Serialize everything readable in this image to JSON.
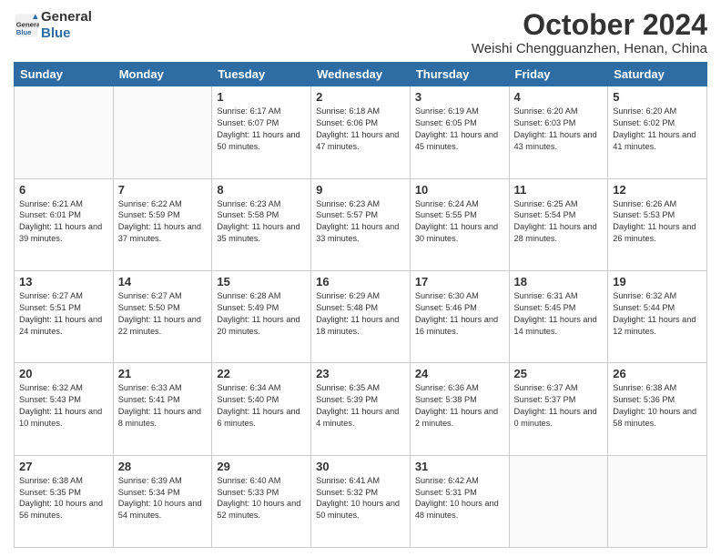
{
  "header": {
    "logo_line1": "General",
    "logo_line2": "Blue",
    "month_title": "October 2024",
    "location": "Weishi Chengguanzhen, Henan, China"
  },
  "days_of_week": [
    "Sunday",
    "Monday",
    "Tuesday",
    "Wednesday",
    "Thursday",
    "Friday",
    "Saturday"
  ],
  "weeks": [
    [
      {
        "day": "",
        "info": ""
      },
      {
        "day": "",
        "info": ""
      },
      {
        "day": "1",
        "info": "Sunrise: 6:17 AM\nSunset: 6:07 PM\nDaylight: 11 hours and 50 minutes."
      },
      {
        "day": "2",
        "info": "Sunrise: 6:18 AM\nSunset: 6:06 PM\nDaylight: 11 hours and 47 minutes."
      },
      {
        "day": "3",
        "info": "Sunrise: 6:19 AM\nSunset: 6:05 PM\nDaylight: 11 hours and 45 minutes."
      },
      {
        "day": "4",
        "info": "Sunrise: 6:20 AM\nSunset: 6:03 PM\nDaylight: 11 hours and 43 minutes."
      },
      {
        "day": "5",
        "info": "Sunrise: 6:20 AM\nSunset: 6:02 PM\nDaylight: 11 hours and 41 minutes."
      }
    ],
    [
      {
        "day": "6",
        "info": "Sunrise: 6:21 AM\nSunset: 6:01 PM\nDaylight: 11 hours and 39 minutes."
      },
      {
        "day": "7",
        "info": "Sunrise: 6:22 AM\nSunset: 5:59 PM\nDaylight: 11 hours and 37 minutes."
      },
      {
        "day": "8",
        "info": "Sunrise: 6:23 AM\nSunset: 5:58 PM\nDaylight: 11 hours and 35 minutes."
      },
      {
        "day": "9",
        "info": "Sunrise: 6:23 AM\nSunset: 5:57 PM\nDaylight: 11 hours and 33 minutes."
      },
      {
        "day": "10",
        "info": "Sunrise: 6:24 AM\nSunset: 5:55 PM\nDaylight: 11 hours and 30 minutes."
      },
      {
        "day": "11",
        "info": "Sunrise: 6:25 AM\nSunset: 5:54 PM\nDaylight: 11 hours and 28 minutes."
      },
      {
        "day": "12",
        "info": "Sunrise: 6:26 AM\nSunset: 5:53 PM\nDaylight: 11 hours and 26 minutes."
      }
    ],
    [
      {
        "day": "13",
        "info": "Sunrise: 6:27 AM\nSunset: 5:51 PM\nDaylight: 11 hours and 24 minutes."
      },
      {
        "day": "14",
        "info": "Sunrise: 6:27 AM\nSunset: 5:50 PM\nDaylight: 11 hours and 22 minutes."
      },
      {
        "day": "15",
        "info": "Sunrise: 6:28 AM\nSunset: 5:49 PM\nDaylight: 11 hours and 20 minutes."
      },
      {
        "day": "16",
        "info": "Sunrise: 6:29 AM\nSunset: 5:48 PM\nDaylight: 11 hours and 18 minutes."
      },
      {
        "day": "17",
        "info": "Sunrise: 6:30 AM\nSunset: 5:46 PM\nDaylight: 11 hours and 16 minutes."
      },
      {
        "day": "18",
        "info": "Sunrise: 6:31 AM\nSunset: 5:45 PM\nDaylight: 11 hours and 14 minutes."
      },
      {
        "day": "19",
        "info": "Sunrise: 6:32 AM\nSunset: 5:44 PM\nDaylight: 11 hours and 12 minutes."
      }
    ],
    [
      {
        "day": "20",
        "info": "Sunrise: 6:32 AM\nSunset: 5:43 PM\nDaylight: 11 hours and 10 minutes."
      },
      {
        "day": "21",
        "info": "Sunrise: 6:33 AM\nSunset: 5:41 PM\nDaylight: 11 hours and 8 minutes."
      },
      {
        "day": "22",
        "info": "Sunrise: 6:34 AM\nSunset: 5:40 PM\nDaylight: 11 hours and 6 minutes."
      },
      {
        "day": "23",
        "info": "Sunrise: 6:35 AM\nSunset: 5:39 PM\nDaylight: 11 hours and 4 minutes."
      },
      {
        "day": "24",
        "info": "Sunrise: 6:36 AM\nSunset: 5:38 PM\nDaylight: 11 hours and 2 minutes."
      },
      {
        "day": "25",
        "info": "Sunrise: 6:37 AM\nSunset: 5:37 PM\nDaylight: 11 hours and 0 minutes."
      },
      {
        "day": "26",
        "info": "Sunrise: 6:38 AM\nSunset: 5:36 PM\nDaylight: 10 hours and 58 minutes."
      }
    ],
    [
      {
        "day": "27",
        "info": "Sunrise: 6:38 AM\nSunset: 5:35 PM\nDaylight: 10 hours and 56 minutes."
      },
      {
        "day": "28",
        "info": "Sunrise: 6:39 AM\nSunset: 5:34 PM\nDaylight: 10 hours and 54 minutes."
      },
      {
        "day": "29",
        "info": "Sunrise: 6:40 AM\nSunset: 5:33 PM\nDaylight: 10 hours and 52 minutes."
      },
      {
        "day": "30",
        "info": "Sunrise: 6:41 AM\nSunset: 5:32 PM\nDaylight: 10 hours and 50 minutes."
      },
      {
        "day": "31",
        "info": "Sunrise: 6:42 AM\nSunset: 5:31 PM\nDaylight: 10 hours and 48 minutes."
      },
      {
        "day": "",
        "info": ""
      },
      {
        "day": "",
        "info": ""
      }
    ]
  ]
}
